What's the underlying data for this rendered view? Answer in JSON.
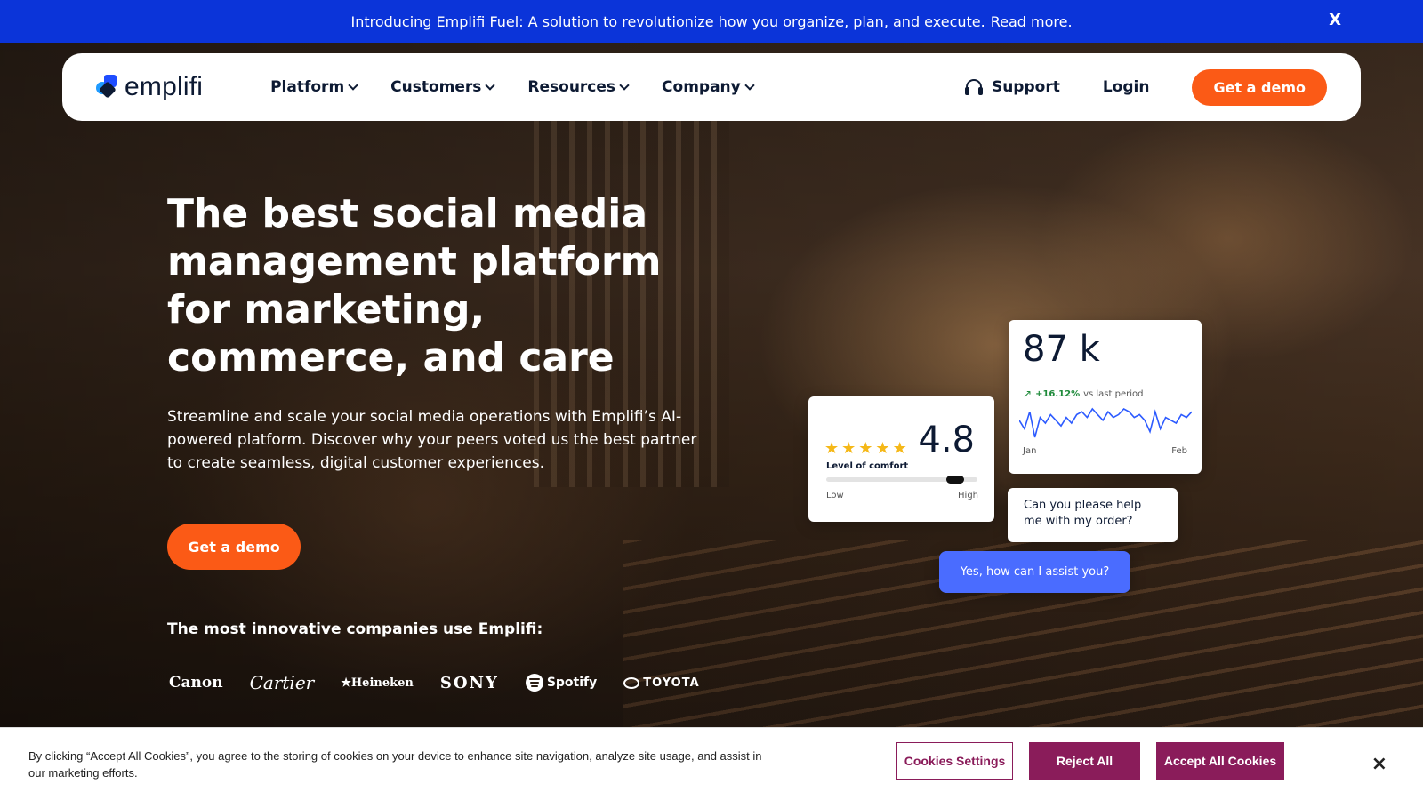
{
  "announcement": {
    "text": "Introducing Emplifi Fuel: A solution to revolutionize how you organize, plan, and execute.",
    "link": "Read more",
    "period": ".",
    "close": "X"
  },
  "nav": {
    "logo": "emplifi",
    "menu": [
      {
        "label": "Platform"
      },
      {
        "label": "Customers"
      },
      {
        "label": "Resources"
      },
      {
        "label": "Company"
      }
    ],
    "support": "Support",
    "login": "Login",
    "demo": "Get a demo"
  },
  "hero": {
    "title": "The best social media management platform for marketing, commerce, and care",
    "subtitle": "Streamline and scale your social media operations with Emplifi’s AI-powered platform. Discover why your peers voted us the best partner to create seamless, digital customer experiences.",
    "cta": "Get a demo",
    "companies_title": "The most innovative companies use Emplifi:",
    "brands": [
      "Canon",
      "Cartier",
      "★Heineken",
      "SONY",
      "Spotify",
      "TOYOTA"
    ]
  },
  "cards": {
    "rating": {
      "value": "4.8",
      "stars": 5,
      "label": "Level of comfort",
      "low": "Low",
      "high": "High",
      "level": 0.9
    },
    "stats": {
      "value": "87 k",
      "trend_pct": "+16.12%",
      "trend_text": "vs last period",
      "start": "Jan",
      "end": "Feb",
      "series": [
        22,
        16,
        28,
        10,
        24,
        20,
        26,
        22,
        18,
        24,
        20,
        26,
        28,
        24,
        30,
        26,
        22,
        28,
        24,
        26,
        30,
        28,
        24,
        26,
        22,
        14,
        28,
        16,
        24,
        22,
        20,
        26,
        24,
        28
      ]
    },
    "chat_in": "Can you please help me with my order?",
    "chat_out": "Yes, how can I assist you?"
  },
  "cookie": {
    "text": "By clicking “Accept All Cookies”, you agree to the storing of cookies on your device to enhance site navigation, analyze site usage, and assist in our marketing efforts.",
    "settings": "Cookies Settings",
    "reject": "Reject All",
    "accept": "Accept All Cookies",
    "close": "×"
  },
  "colors": {
    "announcement_bg": "#0b34d9",
    "accent": "#fb5a16",
    "cookie_btn": "#8a1c5a",
    "chat_out": "#4a6cff"
  }
}
